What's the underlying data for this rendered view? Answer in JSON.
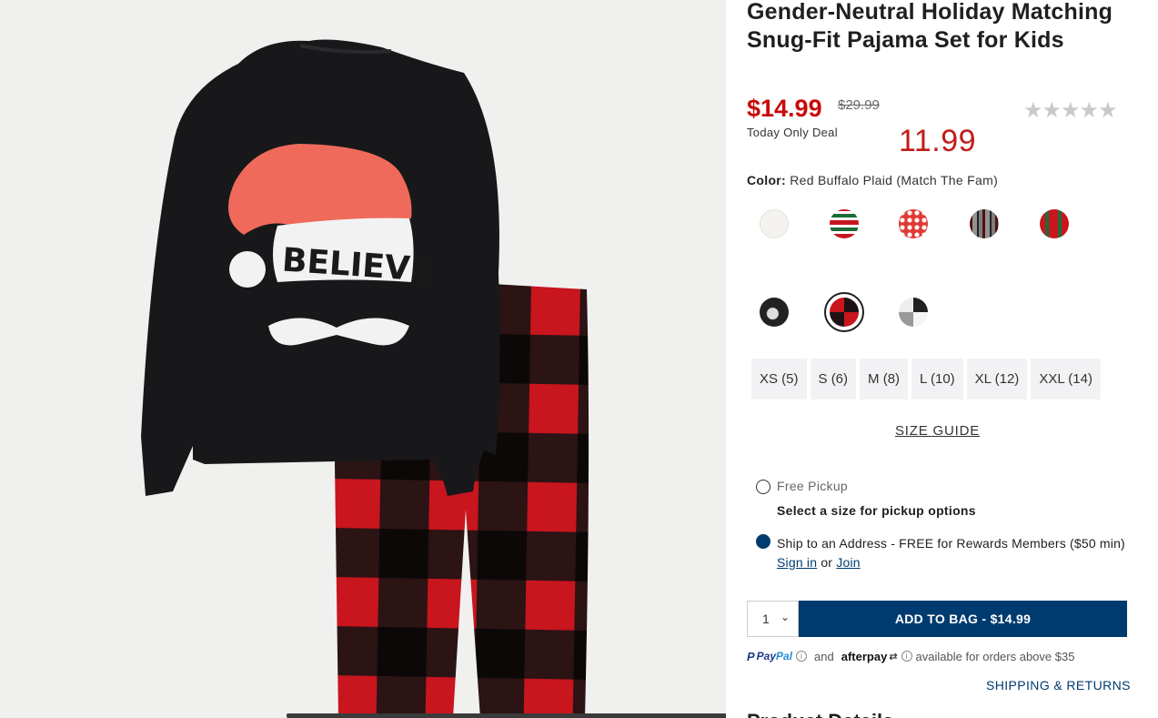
{
  "product": {
    "title": "Gender-Neutral Holiday Matching Snug-Fit Pajama Set for Kids",
    "sale_price": "$14.99",
    "original_price": "$29.99",
    "deal_label": "Today Only Deal",
    "handwritten_note": "11.99",
    "rating_stars": "★★★★★"
  },
  "color": {
    "label": "Color:",
    "value": "Red Buffalo Plaid (Match The Fam)",
    "selected_index": 6
  },
  "sizes": [
    "XS (5)",
    "S (6)",
    "M (8)",
    "L (10)",
    "XL (12)",
    "XXL (14)"
  ],
  "size_guide": "SIZE GUIDE",
  "fulfillment": {
    "pickup_label": "Free Pickup",
    "pickup_note": "Select a size for pickup options",
    "ship_label": "Ship to an Address - FREE for Rewards Members ($50 min)",
    "sign_in": "Sign in",
    "or": "or",
    "join": "Join"
  },
  "purchase": {
    "qty": "1",
    "add_to_bag": "ADD TO BAG  -  $14.99"
  },
  "payments": {
    "paypal_a": "Pay",
    "paypal_b": "Pal",
    "and": "and",
    "afterpay": "afterpay",
    "available": "available for orders above $35"
  },
  "shipping_returns": "SHIPPING & RETURNS",
  "product_details_peek": "Product Details",
  "colors": {
    "accent": "#003b6f",
    "sale": "#c80a0a"
  }
}
